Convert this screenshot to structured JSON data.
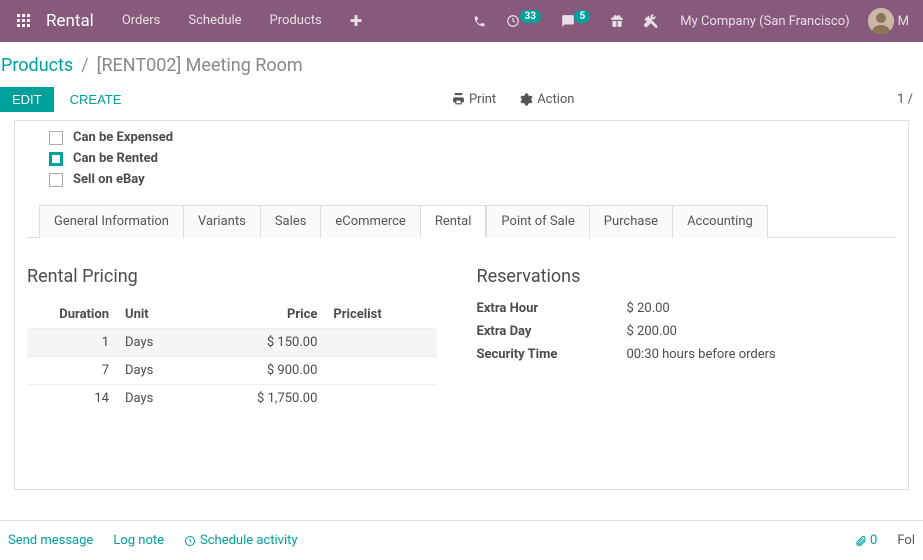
{
  "nav": {
    "brand": "Rental",
    "menu": [
      "Orders",
      "Schedule",
      "Products"
    ],
    "badge1": "33",
    "badge2": "5",
    "company": "My Company (San Francisco)",
    "user_initial": "M"
  },
  "breadcrumb": {
    "root": "Products",
    "current": "[RENT002] Meeting Room"
  },
  "actions": {
    "edit": "EDIT",
    "create": "CREATE",
    "print": "Print",
    "action": "Action",
    "pager": "1 /"
  },
  "checkboxes": [
    {
      "label": "Can be Expensed",
      "checked": false
    },
    {
      "label": "Can be Rented",
      "checked": true
    },
    {
      "label": "Sell on eBay",
      "checked": false
    }
  ],
  "tabs": [
    "General Information",
    "Variants",
    "Sales",
    "eCommerce",
    "Rental",
    "Point of Sale",
    "Purchase",
    "Accounting"
  ],
  "active_tab": "Rental",
  "rental_pricing": {
    "title": "Rental Pricing",
    "headers": {
      "duration": "Duration",
      "unit": "Unit",
      "price": "Price",
      "pricelist": "Pricelist"
    },
    "rows": [
      {
        "duration": "1",
        "unit": "Days",
        "price": "$ 150.00",
        "pricelist": ""
      },
      {
        "duration": "7",
        "unit": "Days",
        "price": "$ 900.00",
        "pricelist": ""
      },
      {
        "duration": "14",
        "unit": "Days",
        "price": "$ 1,750.00",
        "pricelist": ""
      }
    ]
  },
  "reservations": {
    "title": "Reservations",
    "extra_hour_label": "Extra Hour",
    "extra_hour_value": "$ 20.00",
    "extra_day_label": "Extra Day",
    "extra_day_value": "$ 200.00",
    "security_label": "Security Time",
    "security_value": "00:30 hours before orders"
  },
  "bottom": {
    "send": "Send message",
    "log": "Log note",
    "schedule": "Schedule activity",
    "attach_count": "0",
    "follow": "Fol"
  }
}
